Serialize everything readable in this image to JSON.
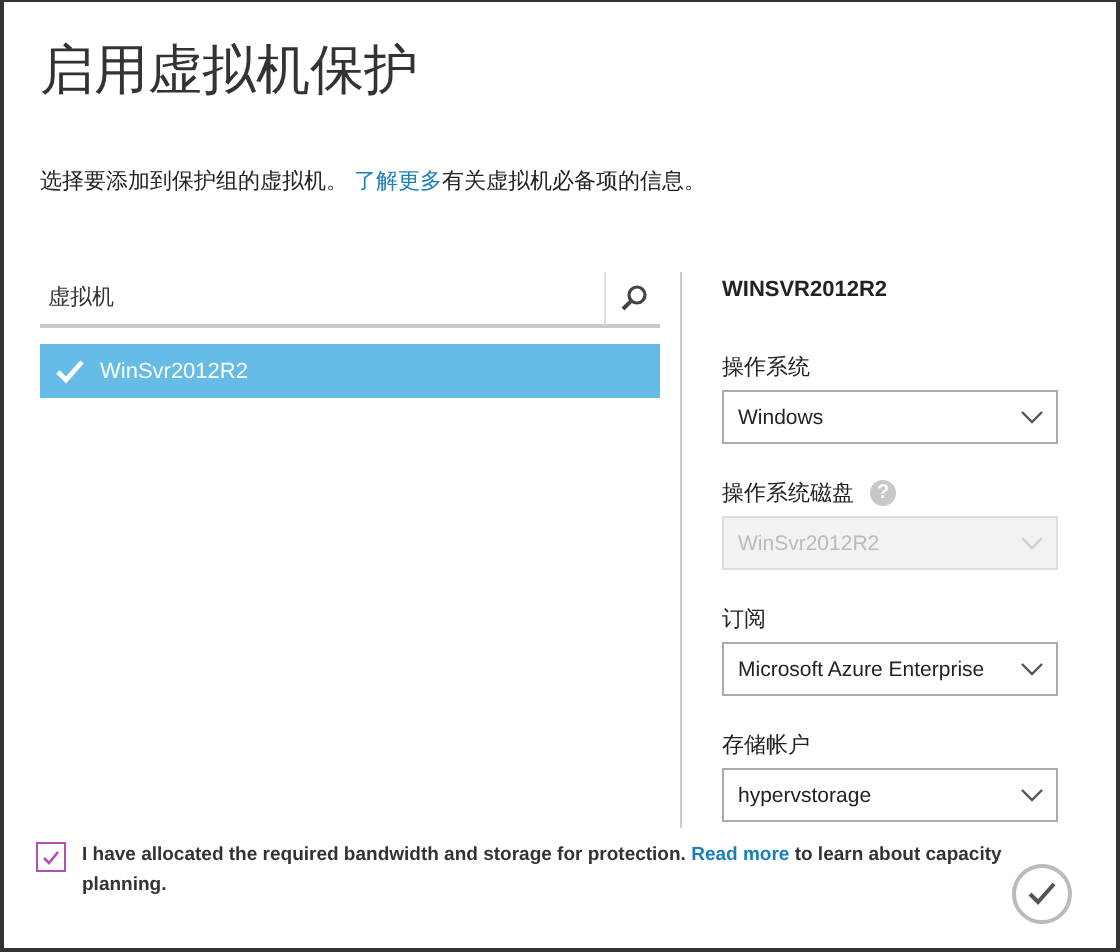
{
  "dialog": {
    "title": "启用虚拟机保护",
    "description": {
      "before": "选择要添加到保护组的虚拟机。 ",
      "link": "了解更多",
      "after": "有关虚拟机必备项的信息。"
    }
  },
  "search": {
    "placeholder": "虚拟机"
  },
  "vms": [
    {
      "name": "WinSvr2012R2",
      "selected": true
    }
  ],
  "details": {
    "heading": "WINSVR2012R2",
    "fields": [
      {
        "label": "操作系统",
        "value": "Windows",
        "disabled": false
      },
      {
        "label": "操作系统磁盘",
        "value": "WinSvr2012R2",
        "disabled": true,
        "help": "?"
      },
      {
        "label": "订阅",
        "value": "Microsoft Azure Enterprise",
        "disabled": false
      },
      {
        "label": "存储帐户",
        "value": "hypervstorage",
        "disabled": false
      }
    ]
  },
  "agreement": {
    "checked": true,
    "before": "I have allocated the required bandwidth and storage for protection. ",
    "link": "Read more",
    "after": " to learn about capacity planning."
  }
}
